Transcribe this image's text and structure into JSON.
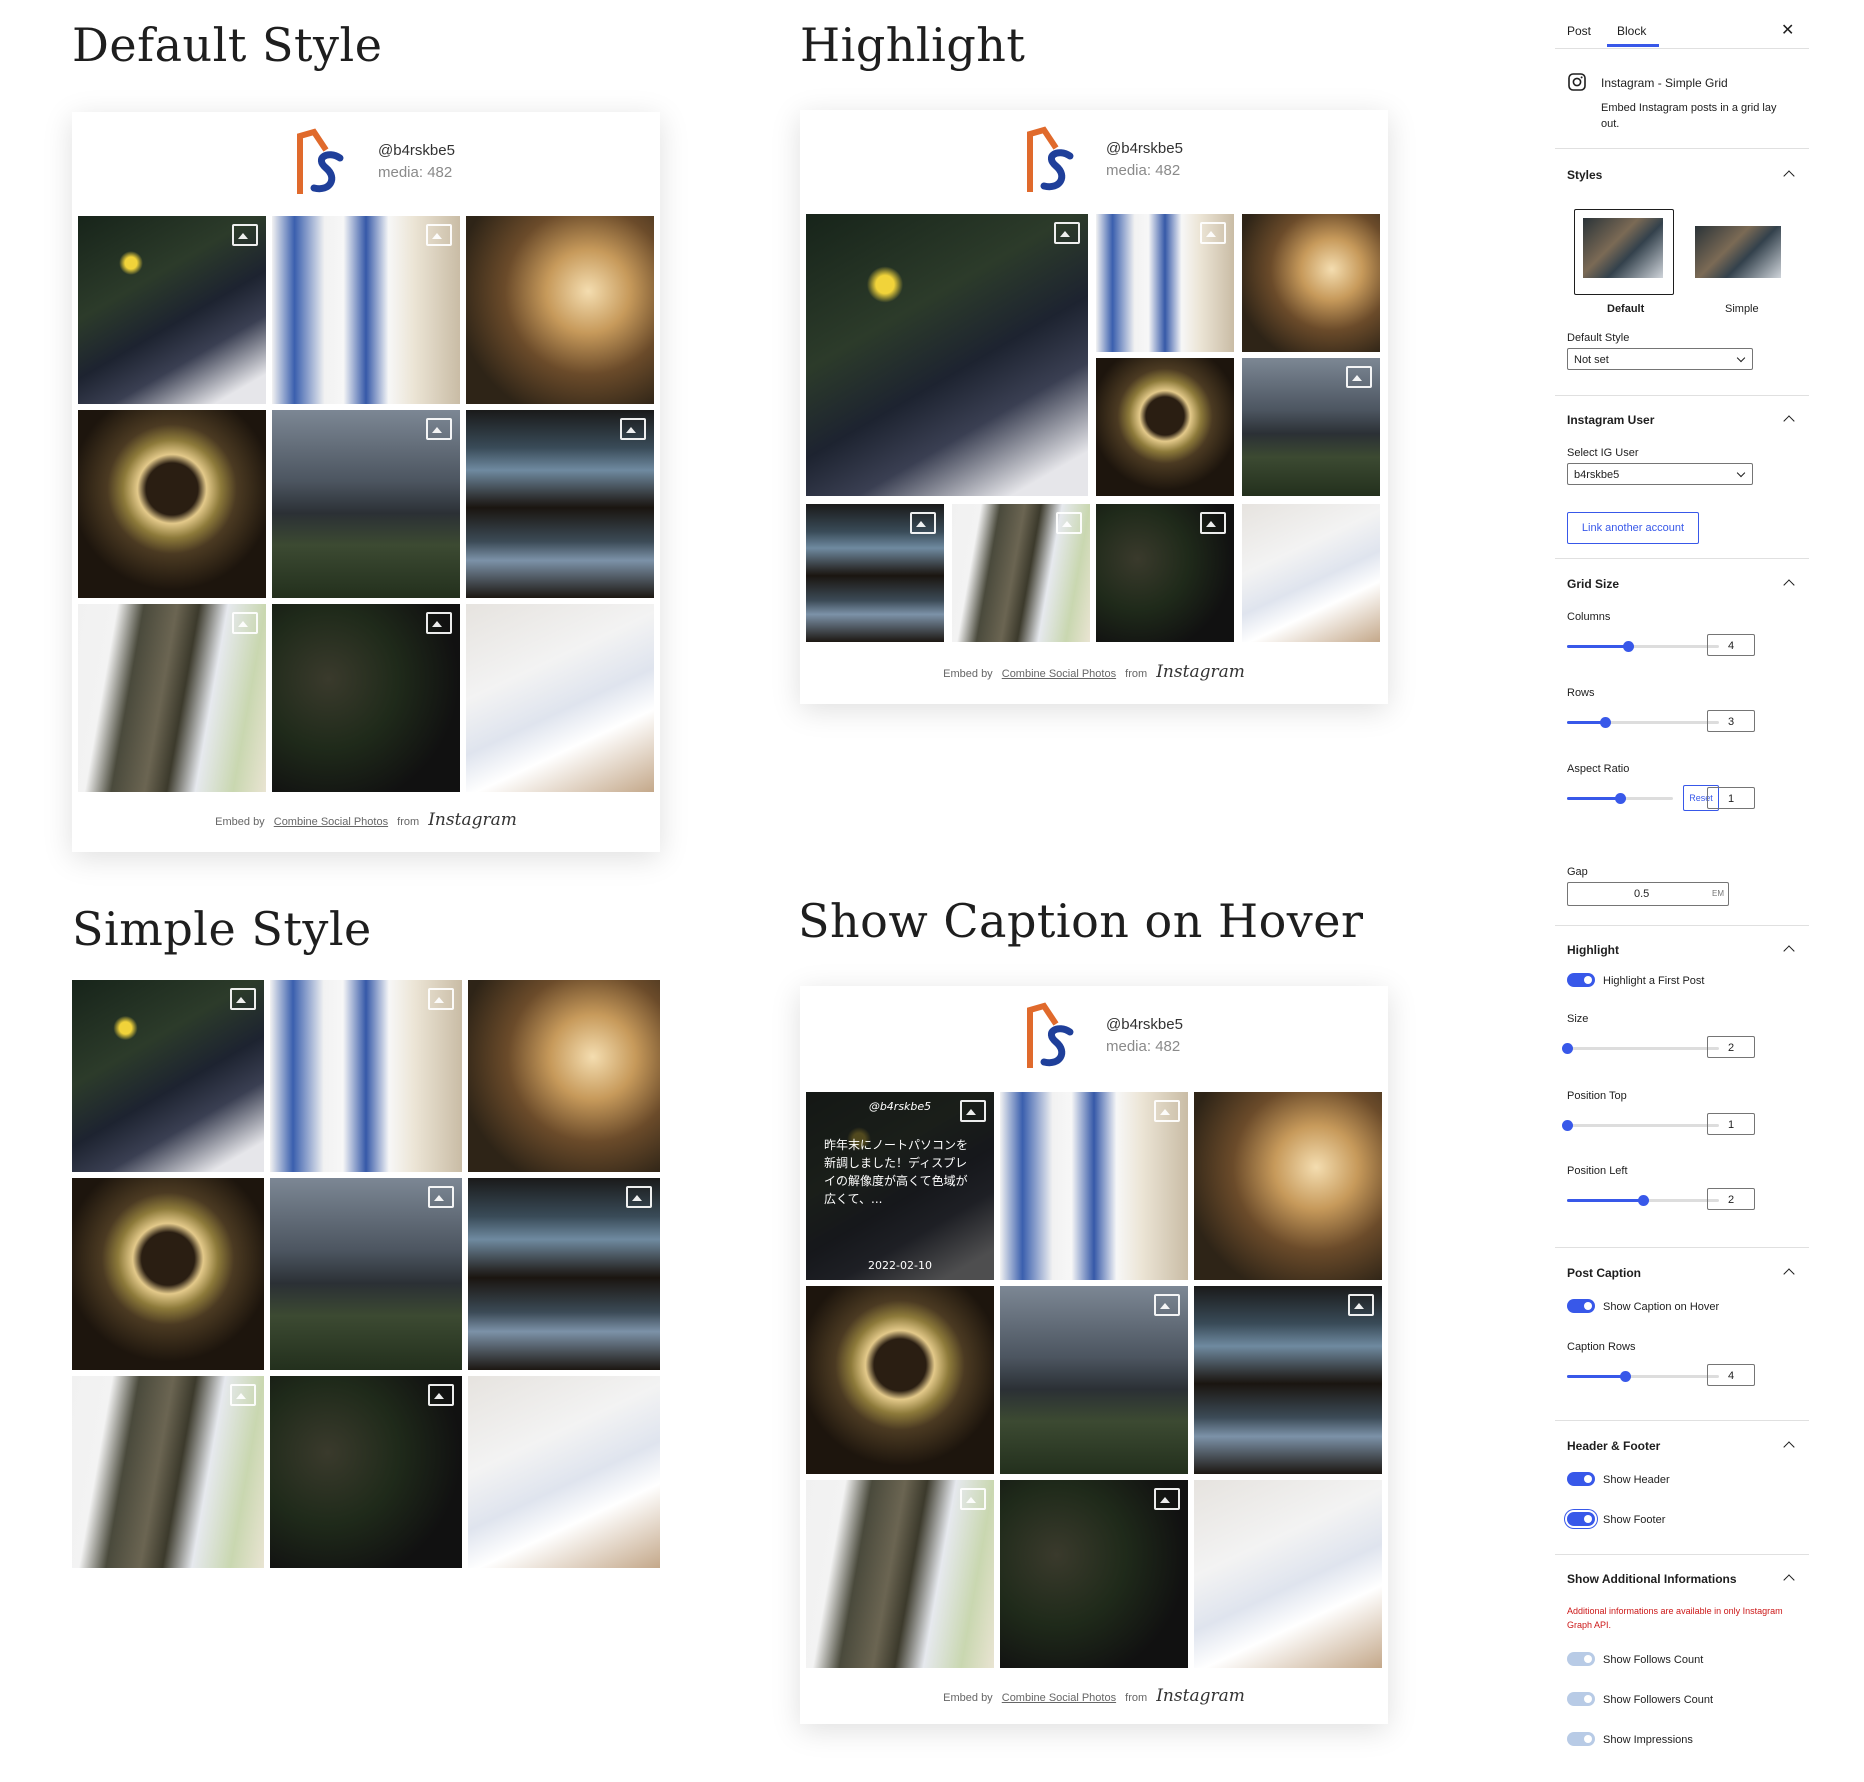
{
  "sections": {
    "default": {
      "heading": "Default Style"
    },
    "highlight": {
      "heading": "Highlight"
    },
    "simple": {
      "heading": "Simple Style"
    },
    "caption": {
      "heading": "Show Caption on Hover"
    }
  },
  "profile": {
    "username": "@b4rskbe5",
    "media": "media: 482"
  },
  "footer": {
    "embed_by": "Embed by",
    "link": "Combine Social Photos",
    "from": "from",
    "brand": "Instagram"
  },
  "hover_caption": {
    "user": "@b4rskbe5",
    "text": "昨年末にノートパソコンを新調しました！ディスプレイの解像度が高くて色域が広くて、...",
    "date": "2022-02-10"
  },
  "icons": {
    "logo": "bs-logo-icon",
    "carousel": "carousel-icon",
    "instagram": "instagram-icon",
    "close": "close-icon",
    "chevron": "chevron-up-icon",
    "select_arrow": "chevron-down-icon"
  },
  "colors": {
    "accent": "#3858e9",
    "logo_orange": "#e06a2c",
    "logo_blue": "#1f3f9a",
    "notice": "#cc1818"
  },
  "sidebar": {
    "tabs": [
      "Post",
      "Block"
    ],
    "active_tab": "Block",
    "block_title": "Instagram - Simple Grid",
    "block_desc": "Embed Instagram posts in a grid lay out.",
    "styles": {
      "title": "Styles",
      "options": [
        "Default",
        "Simple"
      ],
      "selected": "Default",
      "default_style_label": "Default Style",
      "default_style_value": "Not set"
    },
    "instagram_user": {
      "title": "Instagram User",
      "select_label": "Select IG User",
      "select_value": "b4rskbe5",
      "link_button": "Link another account"
    },
    "grid_size": {
      "title": "Grid Size",
      "columns_label": "Columns",
      "columns_value": "4",
      "columns_fill": 0.4,
      "rows_label": "Rows",
      "rows_value": "3",
      "rows_fill": 0.25,
      "aspect_label": "Aspect Ratio",
      "aspect_value": "1",
      "aspect_fill": 0.5,
      "reset": "Reset",
      "gap_label": "Gap",
      "gap_value": "0.5",
      "gap_unit": "EM"
    },
    "highlight": {
      "title": "Highlight",
      "toggle_label": "Highlight a First Post",
      "toggle_on": true,
      "size_label": "Size",
      "size_value": "2",
      "size_fill": 0.0,
      "top_label": "Position Top",
      "top_value": "1",
      "top_fill": 0.0,
      "left_label": "Position Left",
      "left_value": "2",
      "left_fill": 0.5
    },
    "post_caption": {
      "title": "Post Caption",
      "toggle_label": "Show Caption on Hover",
      "toggle_on": true,
      "rows_label": "Caption Rows",
      "rows_value": "4",
      "rows_fill": 0.38
    },
    "header_footer": {
      "title": "Header & Footer",
      "show_header": "Show Header",
      "show_footer": "Show Footer"
    },
    "additional": {
      "title": "Show Additional Informations",
      "notice": "Additional informations are available in only Instagram Graph API.",
      "follows": "Show Follows Count",
      "followers": "Show Followers Count",
      "impressions": "Show Impressions"
    }
  }
}
